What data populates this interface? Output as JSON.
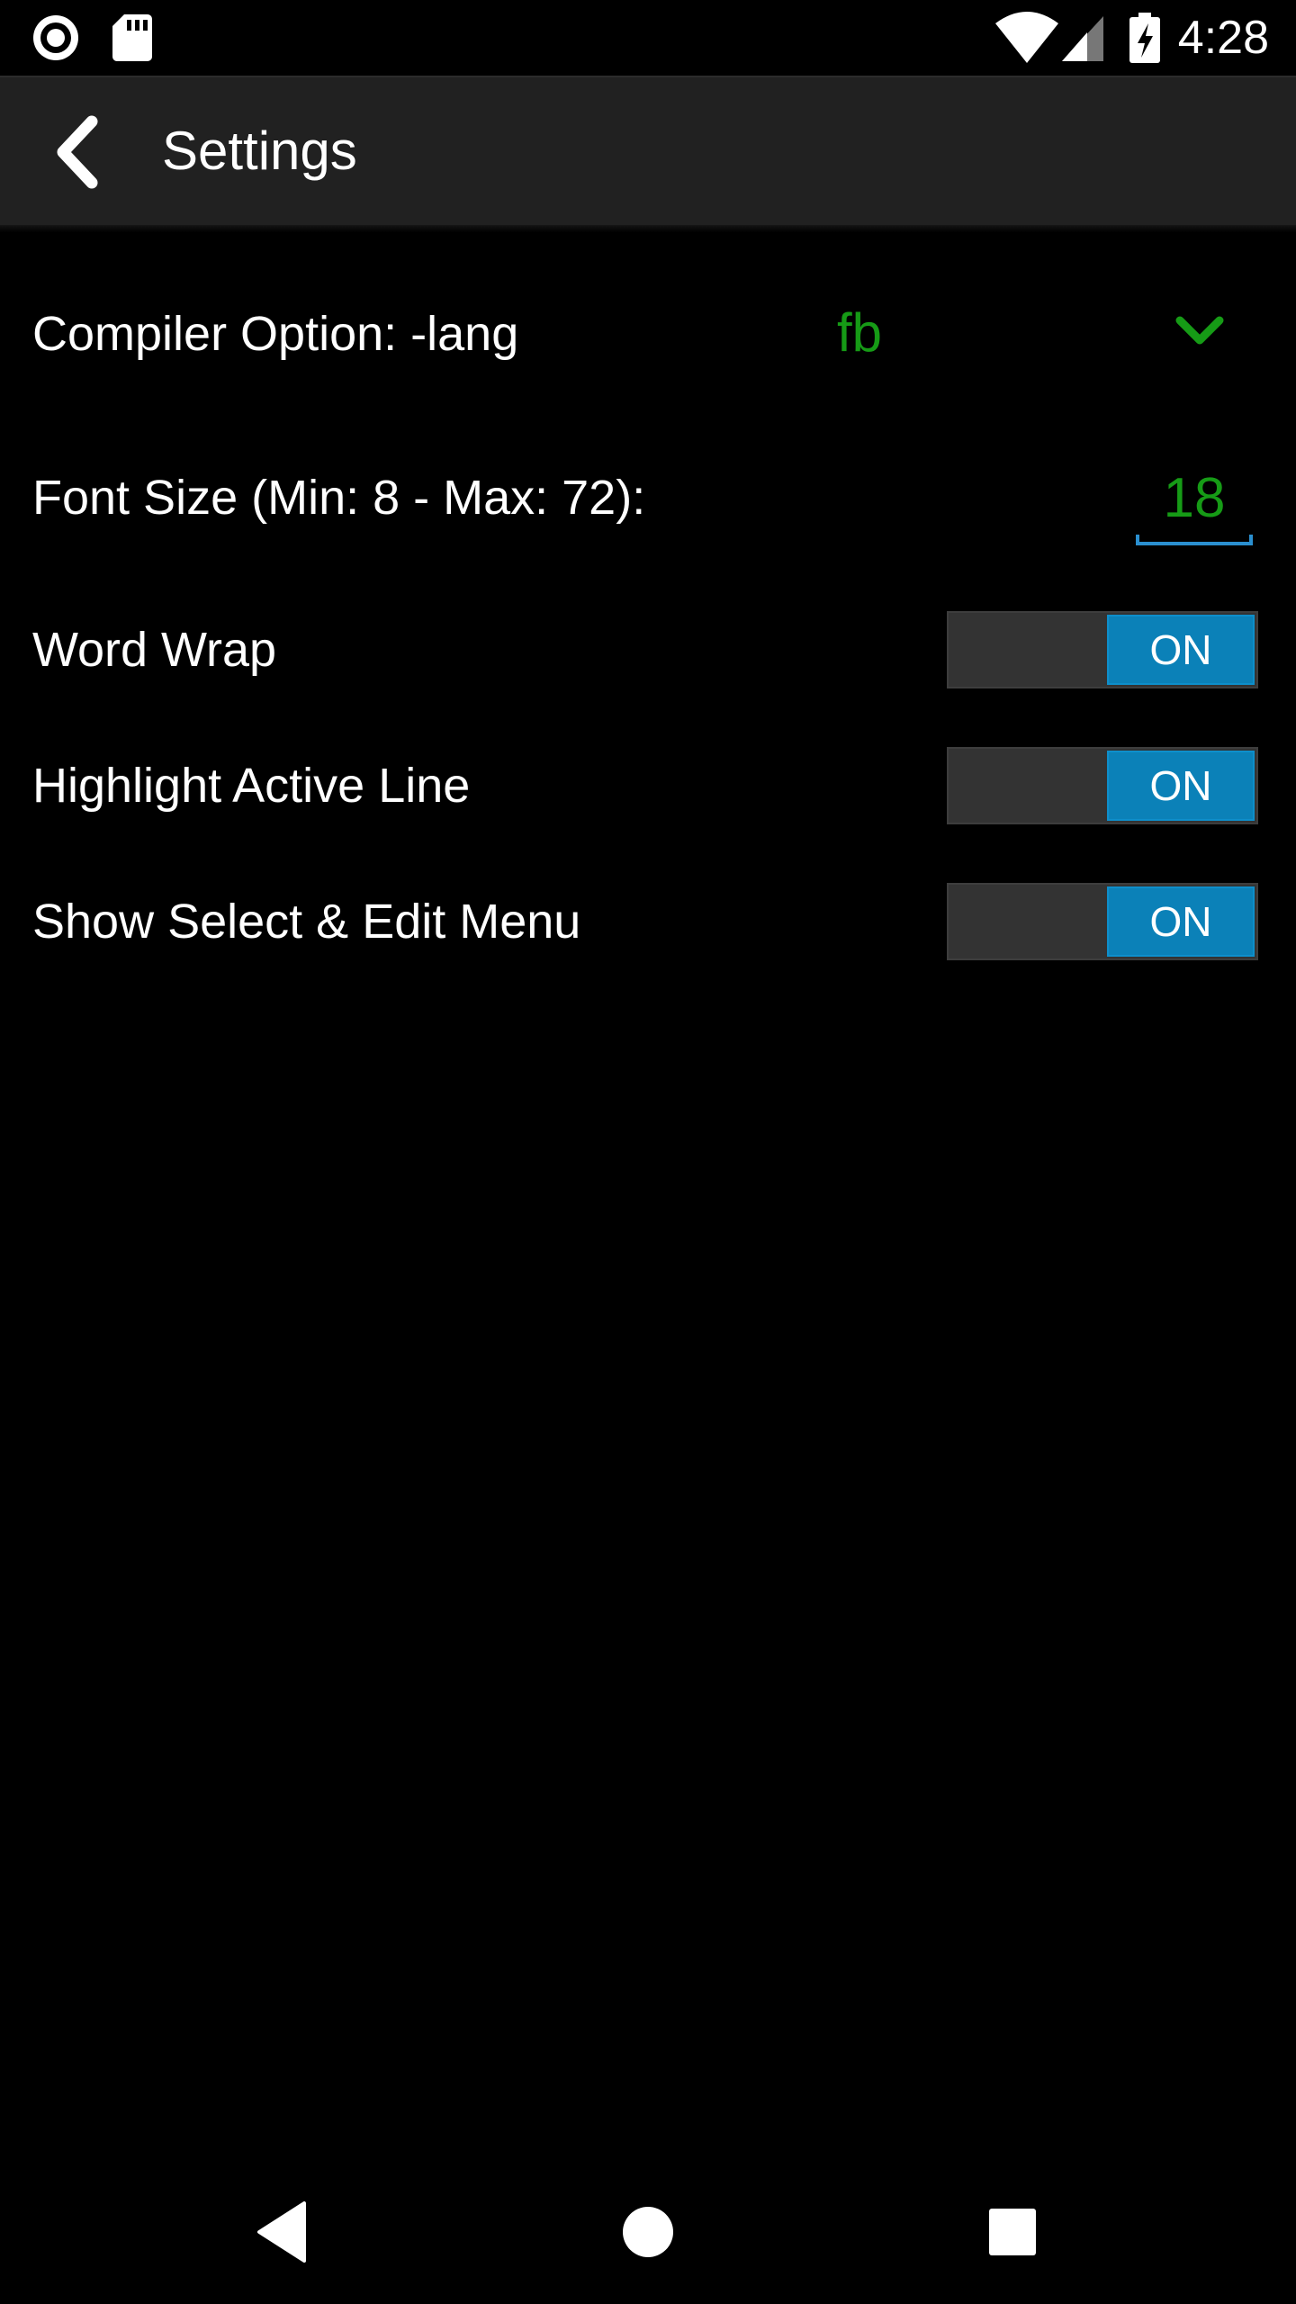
{
  "status_bar": {
    "time": "4:28",
    "icons": [
      "record-icon",
      "sd-card-icon",
      "wifi-icon",
      "cell-signal-icon",
      "battery-charging-icon"
    ]
  },
  "toolbar": {
    "title": "Settings",
    "back_icon": "back-arrow-icon"
  },
  "settings": {
    "compiler_option": {
      "label": "Compiler Option: -lang",
      "value": "fb",
      "icon": "chevron-down-icon"
    },
    "font_size": {
      "label": "Font Size (Min: 8 - Max: 72):",
      "value": "18"
    },
    "word_wrap": {
      "label": "Word Wrap",
      "state": "ON"
    },
    "highlight_active_line": {
      "label": "Highlight Active Line",
      "state": "ON"
    },
    "show_select_edit_menu": {
      "label": "Show Select & Edit Menu",
      "state": "ON"
    }
  },
  "nav_bar": {
    "icons": [
      "nav-back-icon",
      "nav-home-icon",
      "nav-recents-icon"
    ]
  },
  "colors": {
    "accent_green": "#169b16",
    "toggle_blue": "#0b81b8",
    "underline_blue": "#2a8fcf",
    "toolbar_bg": "#212121"
  }
}
